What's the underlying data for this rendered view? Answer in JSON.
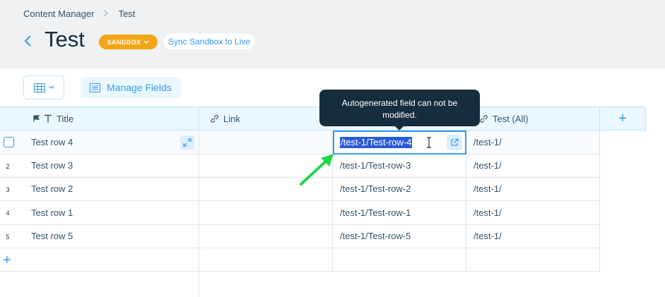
{
  "breadcrumb": {
    "root": "Content Manager",
    "current": "Test"
  },
  "page": {
    "title": "Test",
    "badge": "SANDBOX",
    "sync_label": "Sync Sandbox to Live"
  },
  "toolbar": {
    "manage_fields": "Manage Fields"
  },
  "table": {
    "columns": [
      {
        "label": "Title",
        "icon": "text-icon"
      },
      {
        "label": "Link",
        "icon": "link-icon"
      },
      {
        "label": "Test (All)",
        "icon": "link-icon"
      }
    ],
    "rows": [
      {
        "num": "",
        "title": "Test row 4",
        "link": "",
        "slug": "/test-1/Test-row-4",
        "all": "/test-1/"
      },
      {
        "num": "2",
        "title": "Test row 3",
        "link": "",
        "slug": "/test-1/Test-row-3",
        "all": "/test-1/"
      },
      {
        "num": "3",
        "title": "Test row 2",
        "link": "",
        "slug": "/test-1/Test-row-2",
        "all": "/test-1/"
      },
      {
        "num": "4",
        "title": "Test row 1",
        "link": "",
        "slug": "/test-1/Test-row-1",
        "all": "/test-1/"
      },
      {
        "num": "5",
        "title": "Test row 5",
        "link": "",
        "slug": "/test-1/Test-row-5",
        "all": "/test-1/"
      }
    ]
  },
  "tooltip": {
    "line1": "Autogenerated field can not be",
    "line2": "modified."
  },
  "colors": {
    "accent": "#3899ec",
    "badge": "#f2a516",
    "tooltip": "#162d3d",
    "arrow": "#22d64a"
  }
}
